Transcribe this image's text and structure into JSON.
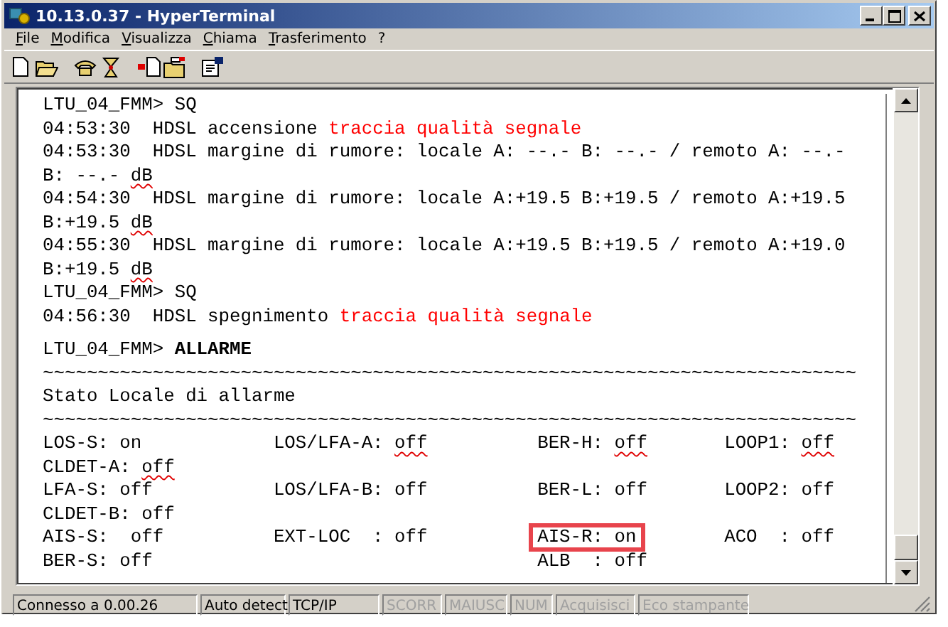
{
  "window": {
    "title": "10.13.0.37 - HyperTerminal"
  },
  "menu": [
    {
      "label": "File"
    },
    {
      "label": "Modifica"
    },
    {
      "label": "Visualizza"
    },
    {
      "label": "Chiama"
    },
    {
      "label": "Trasferimento"
    },
    {
      "label": "?"
    }
  ],
  "terminal": {
    "lines": [
      {
        "kind": "text",
        "segments": [
          {
            "text": "LTU_04_FMM> SQ",
            "kind": "plain"
          }
        ]
      },
      {
        "kind": "text",
        "segments": [
          {
            "text": "04:53:30  HDSL accensione ",
            "kind": "plain"
          },
          {
            "text": "traccia qualità segnale",
            "kind": "red"
          }
        ]
      },
      {
        "kind": "text",
        "segments": [
          {
            "text": "04:53:30  HDSL margine di rumore: locale A: --.- B: --.- / remoto A: --.-",
            "kind": "plain"
          }
        ]
      },
      {
        "kind": "text",
        "segments": [
          {
            "text": "B: --.- ",
            "kind": "plain"
          },
          {
            "text": "dB",
            "kind": "misspelled"
          }
        ]
      },
      {
        "kind": "text",
        "segments": [
          {
            "text": "04:54:30  HDSL margine di rumore: locale A:+19.5 B:+19.5 / remoto A:+19.5",
            "kind": "plain"
          }
        ]
      },
      {
        "kind": "text",
        "segments": [
          {
            "text": "B:+19.5 ",
            "kind": "plain"
          },
          {
            "text": "dB",
            "kind": "misspelled"
          }
        ]
      },
      {
        "kind": "text",
        "segments": [
          {
            "text": "04:55:30  HDSL margine di rumore: locale A:+19.5 B:+19.5 / remoto A:+19.0",
            "kind": "plain"
          }
        ]
      },
      {
        "kind": "text",
        "segments": [
          {
            "text": "B:+19.5 ",
            "kind": "plain"
          },
          {
            "text": "dB",
            "kind": "misspelled"
          }
        ]
      },
      {
        "kind": "text",
        "segments": [
          {
            "text": "LTU_04_FMM> SQ",
            "kind": "plain"
          }
        ]
      },
      {
        "kind": "text",
        "segments": [
          {
            "text": "04:56:30  HDSL spegnimento ",
            "kind": "plain"
          },
          {
            "text": "traccia qualità segnale",
            "kind": "red"
          }
        ]
      },
      {
        "kind": "blank"
      },
      {
        "kind": "text",
        "segments": [
          {
            "text": "LTU_04_FMM> ",
            "kind": "plain"
          },
          {
            "text": "ALLARME",
            "kind": "bold"
          }
        ]
      },
      {
        "kind": "text",
        "segments": [
          {
            "text": "~~~~~~~~~~~~~~~~~~~~~~~~~~~~~~~~~~~~~~~~~~~~~~~~~~~~~~~~~~~~~~~~~~~~~~~~~~",
            "kind": "plain"
          }
        ]
      },
      {
        "kind": "text",
        "segments": [
          {
            "text": "Stato Locale di allarme",
            "kind": "plain"
          }
        ]
      },
      {
        "kind": "text",
        "segments": [
          {
            "text": "~~~~~~~~~~~~~~~~~~~~~~~~~~~~~~~~~~~~~~~~~~~~~~~~~~~~~~~~~~~~~~~~~~~~~~~~~~",
            "kind": "plain"
          }
        ]
      },
      {
        "kind": "alarms",
        "cells": [
          {
            "label": "LOS-S:",
            "value": "on",
            "misspelled": false,
            "highlighted": false
          },
          {
            "label": "LOS/LFA-A:",
            "value": "off",
            "misspelled": true,
            "highlighted": false
          },
          {
            "label": "BER-H:",
            "value": "off",
            "misspelled": true,
            "highlighted": false
          },
          {
            "label": "LOOP1:",
            "value": "off",
            "misspelled": true,
            "highlighted": false
          }
        ]
      },
      {
        "kind": "alarms",
        "cells": [
          {
            "label": "CLDET-A:",
            "value": "off",
            "misspelled": true,
            "highlighted": false
          },
          null,
          null,
          null
        ]
      },
      {
        "kind": "alarms",
        "cells": [
          {
            "label": "LFA-S:",
            "value": "off",
            "misspelled": false,
            "highlighted": false
          },
          {
            "label": "LOS/LFA-B:",
            "value": "off",
            "misspelled": false,
            "highlighted": false
          },
          {
            "label": "BER-L:",
            "value": "off",
            "misspelled": false,
            "highlighted": false
          },
          {
            "label": "LOOP2:",
            "value": "off",
            "misspelled": false,
            "highlighted": false
          }
        ]
      },
      {
        "kind": "alarms",
        "cells": [
          {
            "label": "CLDET-B:",
            "value": "off",
            "misspelled": false,
            "highlighted": false
          },
          null,
          null,
          null
        ]
      },
      {
        "kind": "alarms",
        "cells": [
          {
            "label": "AIS-S: ",
            "value": "off",
            "misspelled": false,
            "highlighted": false
          },
          {
            "label": "EXT-LOC  :",
            "value": "off",
            "misspelled": false,
            "highlighted": false
          },
          {
            "label": "AIS-R:",
            "value": "on",
            "misspelled": false,
            "highlighted": true
          },
          {
            "label": "ACO  :",
            "value": "off",
            "misspelled": false,
            "highlighted": false
          }
        ]
      },
      {
        "kind": "alarms",
        "cells": [
          {
            "label": "BER-S:",
            "value": "off",
            "misspelled": false,
            "highlighted": false
          },
          null,
          {
            "label": "ALB  :",
            "value": "off",
            "misspelled": false,
            "highlighted": false
          },
          null
        ]
      }
    ]
  },
  "status_bar": [
    {
      "text": "Connesso a 0.00.26",
      "disabled": false
    },
    {
      "text": "Auto detect",
      "disabled": false
    },
    {
      "text": "TCP/IP",
      "disabled": false
    },
    {
      "text": "SCORR",
      "disabled": true
    },
    {
      "text": "MAIUSC",
      "disabled": true
    },
    {
      "text": "NUM",
      "disabled": true
    },
    {
      "text": "Acquisisci",
      "disabled": true
    },
    {
      "text": "Eco stampante",
      "disabled": true
    }
  ]
}
